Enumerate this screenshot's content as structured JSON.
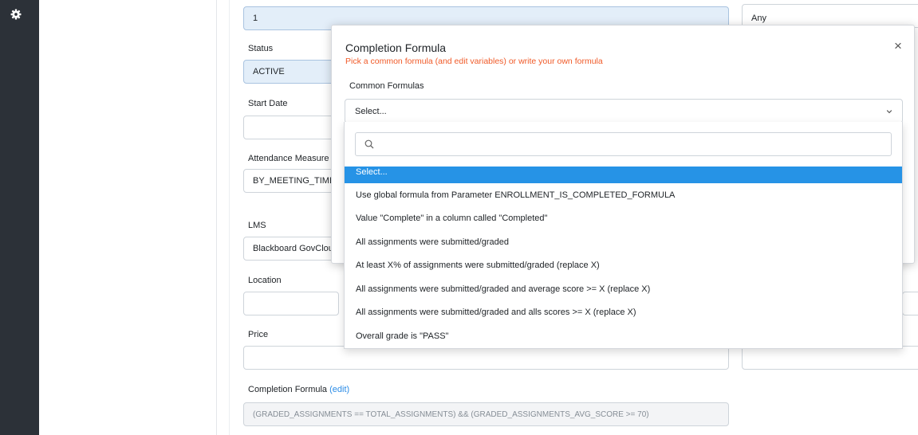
{
  "colors": {
    "accent": "#2693e6",
    "warning": "#f05a28",
    "sidebar": "#2c3138"
  },
  "sidebar": {
    "icon": "gear-icon"
  },
  "form": {
    "top_value": "1",
    "right_top_value": "Any",
    "status_label": "Status",
    "status_value": "ACTIVE",
    "start_date_label": "Start Date",
    "start_date_value": "",
    "attendance_label": "Attendance Measure",
    "attendance_value": "BY_MEETING_TIMES",
    "lms_label": "LMS",
    "lms_value": "Blackboard GovCloud",
    "location_label": "Location",
    "location_value": "",
    "price_label": "Price",
    "price_value": "",
    "completion_label": "Completion Formula",
    "completion_edit": "(edit)",
    "completion_value": "(GRADED_ASSIGNMENTS == TOTAL_ASSIGNMENTS) && (GRADED_ASSIGNMENTS_AVG_SCORE >= 70)"
  },
  "modal": {
    "title": "Completion Formula",
    "subtitle": "Pick a common formula (and edit variables) or write your own formula",
    "close": "×",
    "section_label": "Common Formulas",
    "select_value": "Select..."
  },
  "dropdown": {
    "search_placeholder": "",
    "options": [
      "Select...",
      "Use global formula from Parameter ENROLLMENT_IS_COMPLETED_FORMULA",
      "Value \"Complete\" in a column called \"Completed\"",
      "All assignments were submitted/graded",
      "At least X% of assignments were submitted/graded (replace X)",
      "All assignments were submitted/graded and average score >= X (replace X)",
      "All assignments were submitted/graded and alls scores >= X (replace X)",
      "Overall grade is \"PASS\""
    ]
  }
}
